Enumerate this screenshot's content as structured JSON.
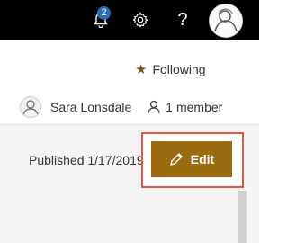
{
  "topbar": {
    "notification_count": "2",
    "help_label": "?",
    "icons": [
      "bell-icon",
      "gear-icon",
      "help-icon",
      "avatar"
    ]
  },
  "site": {
    "following_label": "Following",
    "owner_name": "Sara Lonsdale",
    "member_count_label": "1 member"
  },
  "page": {
    "published_label": "Published 1/17/2019",
    "edit_label": "Edit"
  },
  "colors": {
    "topbar_bg": "#000000",
    "badge_bg": "#2a6db5",
    "edit_button_bg": "#9a6b10",
    "highlight_border": "#e0574a"
  }
}
